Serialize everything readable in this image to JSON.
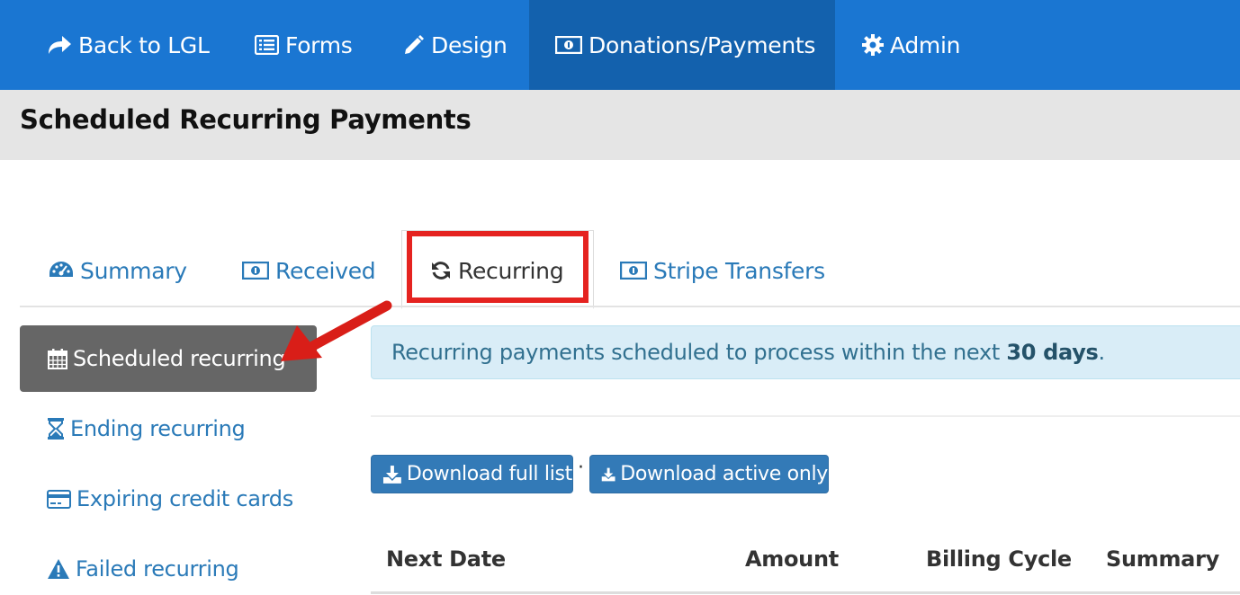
{
  "topnav": {
    "items": [
      {
        "label": "Back to LGL",
        "icon": "share-arrow-icon"
      },
      {
        "label": "Forms",
        "icon": "list-icon"
      },
      {
        "label": "Design",
        "icon": "pencil-icon"
      },
      {
        "label": "Donations/Payments",
        "icon": "money-icon",
        "active": true
      },
      {
        "label": "Admin",
        "icon": "gear-icon"
      }
    ],
    "bg_color": "#1a76d2",
    "active_bg_color": "#1361ad"
  },
  "page": {
    "title": "Scheduled Recurring Payments"
  },
  "tabs": [
    {
      "label": "Summary",
      "icon": "dashboard-icon"
    },
    {
      "label": "Received",
      "icon": "money-icon"
    },
    {
      "label": "Recurring",
      "icon": "refresh-icon",
      "active": true
    },
    {
      "label": "Stripe Transfers",
      "icon": "money-icon"
    }
  ],
  "sidebar": {
    "items": [
      {
        "label": "Scheduled recurring",
        "icon": "calendar-icon",
        "active": true
      },
      {
        "label": "Ending recurring",
        "icon": "hourglass-icon"
      },
      {
        "label": "Expiring credit cards",
        "icon": "credit-card-icon"
      },
      {
        "label": "Failed recurring",
        "icon": "warning-icon"
      }
    ]
  },
  "alert": {
    "text_before": "Recurring payments scheduled to process within the next ",
    "text_bold": "30 days",
    "text_after": "."
  },
  "buttons": {
    "download_full": "Download full list",
    "separator": "·",
    "download_active": "Download active only"
  },
  "table": {
    "columns": [
      "Next Date",
      "Amount",
      "Billing Cycle",
      "Summary"
    ]
  },
  "annotations": {
    "highlight_color": "#e52320"
  }
}
